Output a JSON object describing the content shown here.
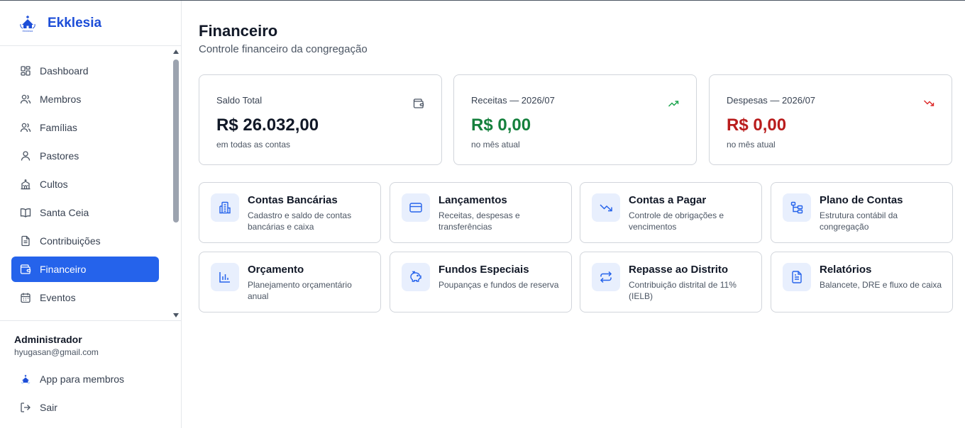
{
  "brand": {
    "name": "Ekklesia",
    "logo_caption": "Ekklesia"
  },
  "sidebar": {
    "items": [
      {
        "label": "Dashboard",
        "icon": "grid-icon"
      },
      {
        "label": "Membros",
        "icon": "users-icon"
      },
      {
        "label": "Famílias",
        "icon": "users-icon"
      },
      {
        "label": "Pastores",
        "icon": "user-icon"
      },
      {
        "label": "Cultos",
        "icon": "church-icon"
      },
      {
        "label": "Santa Ceia",
        "icon": "book-icon"
      },
      {
        "label": "Contribuições",
        "icon": "file-text-icon"
      },
      {
        "label": "Financeiro",
        "icon": "wallet-icon",
        "active": true
      },
      {
        "label": "Eventos",
        "icon": "calendar-icon"
      }
    ]
  },
  "user": {
    "role": "Administrador",
    "email": "hyugasan@gmail.com",
    "app_label": "App para membros",
    "logout_label": "Sair"
  },
  "page": {
    "title": "Financeiro",
    "subtitle": "Controle financeiro da congregação"
  },
  "stats": [
    {
      "label": "Saldo Total",
      "value": "R$ 26.032,00",
      "sub": "em todas as contas",
      "color": "#111827",
      "icon": "wallet-icon"
    },
    {
      "label": "Receitas — 2026/07",
      "value": "R$ 0,00",
      "sub": "no mês atual",
      "color": "#15803d",
      "icon": "trending-up-icon"
    },
    {
      "label": "Despesas — 2026/07",
      "value": "R$ 0,00",
      "sub": "no mês atual",
      "color": "#b91c1c",
      "icon": "trending-down-icon"
    }
  ],
  "cards": [
    {
      "title": "Contas Bancárias",
      "desc": "Cadastro e saldo de contas bancárias e caixa",
      "icon": "bank-icon"
    },
    {
      "title": "Lançamentos",
      "desc": "Receitas, despesas e transferências",
      "icon": "credit-card-icon"
    },
    {
      "title": "Contas a Pagar",
      "desc": "Controle de obrigações e vencimentos",
      "icon": "trending-down-icon"
    },
    {
      "title": "Plano de Contas",
      "desc": "Estrutura contábil da congregação",
      "icon": "tree-icon"
    },
    {
      "title": "Orçamento",
      "desc": "Planejamento orçamentário anual",
      "icon": "bar-chart-icon"
    },
    {
      "title": "Fundos Especiais",
      "desc": "Poupanças e fundos de reserva",
      "icon": "piggy-bank-icon"
    },
    {
      "title": "Repasse ao Distrito",
      "desc": "Contribuição distrital de 11% (IELB)",
      "icon": "arrows-exchange-icon"
    },
    {
      "title": "Relatórios",
      "desc": "Balancete, DRE e fluxo de caixa",
      "icon": "file-text-icon"
    }
  ],
  "colors": {
    "accent": "#2563eb",
    "income": "#15803d",
    "expense": "#b91c1c"
  }
}
